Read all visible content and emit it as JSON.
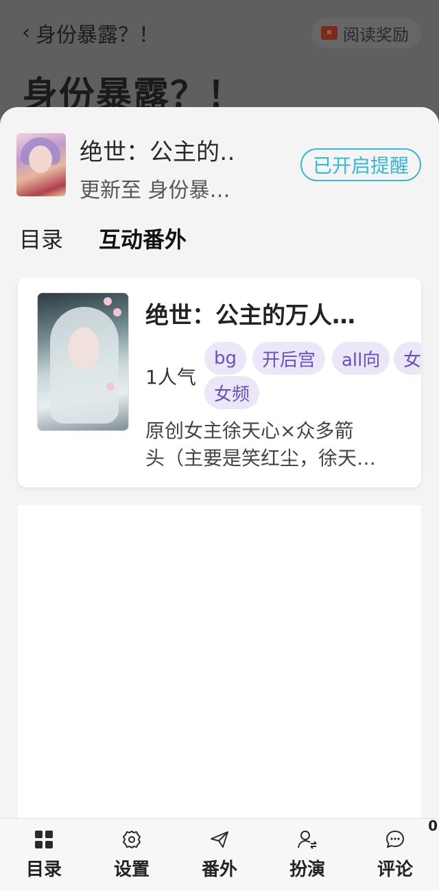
{
  "background": {
    "back_title": "身份暴露？！",
    "reward_label": "阅读奖励",
    "chapter_title": "身份暴露？！"
  },
  "novel": {
    "title": "绝世：公主的‥",
    "update": "更新至 身份暴…",
    "remind_label": "已开启提醒"
  },
  "tabs": [
    {
      "label": "目录"
    },
    {
      "label": "互动番外"
    }
  ],
  "card": {
    "title": "绝世：公主的万人…",
    "popularity": "1人气",
    "tags": [
      "bg",
      "开后宫",
      "all向",
      "女",
      "女频"
    ],
    "desc_line1": "原创女主徐天心×众多箭",
    "desc_line2": "头（主要是笑红尘，徐天…"
  },
  "bottom_nav": [
    {
      "label": "目录",
      "icon": "grid-icon"
    },
    {
      "label": "设置",
      "icon": "gear-icon"
    },
    {
      "label": "番外",
      "icon": "paper-plane-icon"
    },
    {
      "label": "扮演",
      "icon": "user-switch-icon"
    },
    {
      "label": "评论",
      "icon": "chat-bubble-icon",
      "badge": "0"
    }
  ],
  "colors": {
    "accent": "#35b7d8",
    "tag_bg": "#ece7f8",
    "tag_text": "#6a4fc0"
  }
}
